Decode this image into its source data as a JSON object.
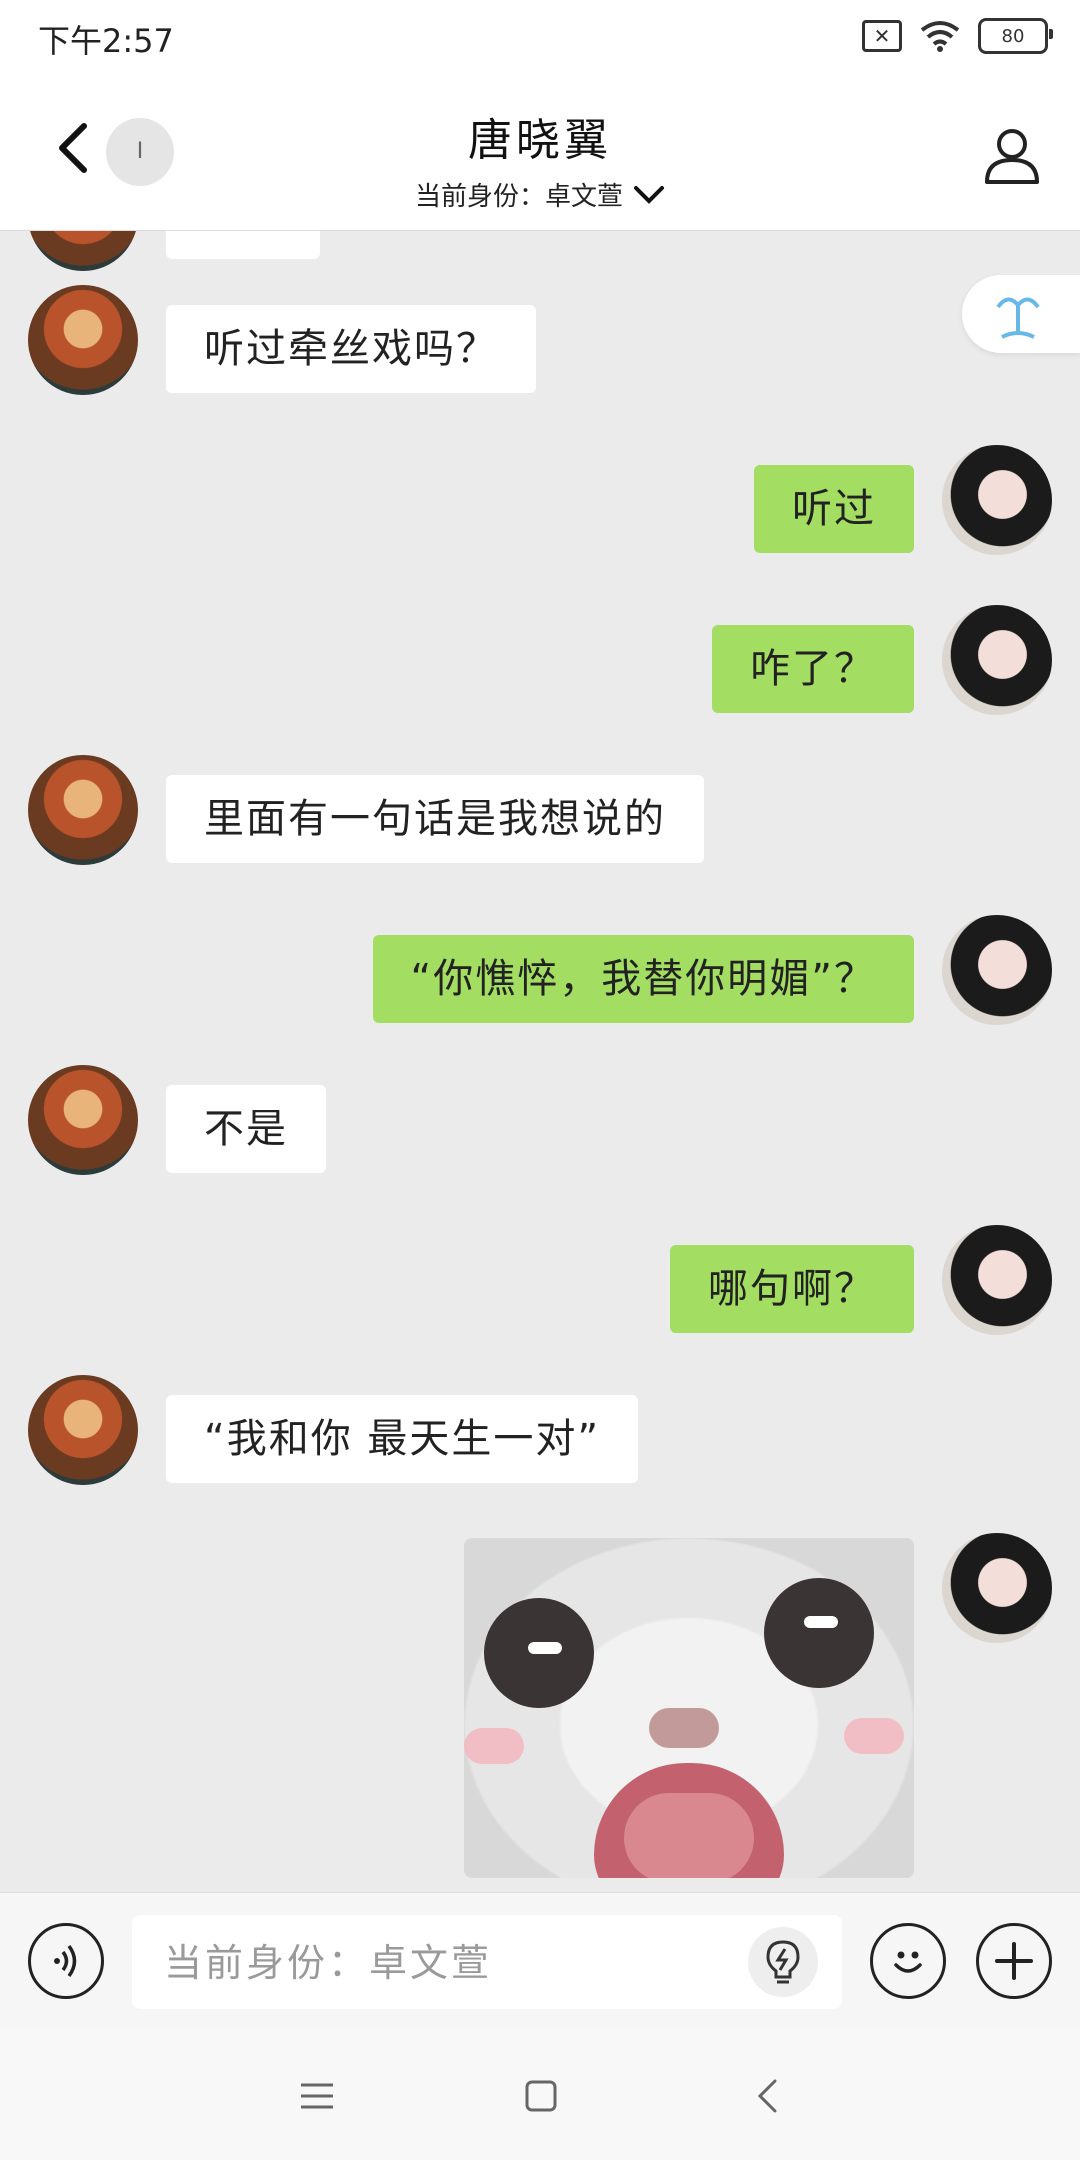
{
  "status_bar": {
    "time": "下午2:57",
    "battery": "80"
  },
  "header": {
    "unread_badge": "I",
    "title": "唐晓翼",
    "identity_label": "当前身份：卓文萱"
  },
  "messages": [
    {
      "side": "left",
      "text": "听过牵丝戏吗？"
    },
    {
      "side": "right",
      "text": "听过"
    },
    {
      "side": "right",
      "text": "咋了？"
    },
    {
      "side": "left",
      "text": "里面有一句话是我想说的"
    },
    {
      "side": "right",
      "text": "“你憔悴，我替你明媚”？"
    },
    {
      "side": "left",
      "text": "不是"
    },
    {
      "side": "right",
      "text": "哪句啊？"
    },
    {
      "side": "left",
      "text": "“我和你 最天生一对”"
    },
    {
      "side": "right",
      "type": "sticker",
      "icon": "surprised-cat-sticker"
    }
  ],
  "input": {
    "placeholder": "当前身份：卓文萱"
  },
  "icons": {
    "back": "chevron-left-icon",
    "profile": "person-icon",
    "voice": "voice-icon",
    "hint": "lightbulb-icon",
    "emoji": "smiley-icon",
    "plus": "plus-icon"
  },
  "colors": {
    "bubble_right": "#a3dd62",
    "bubble_left": "#ffffff",
    "background": "#ebebeb"
  }
}
